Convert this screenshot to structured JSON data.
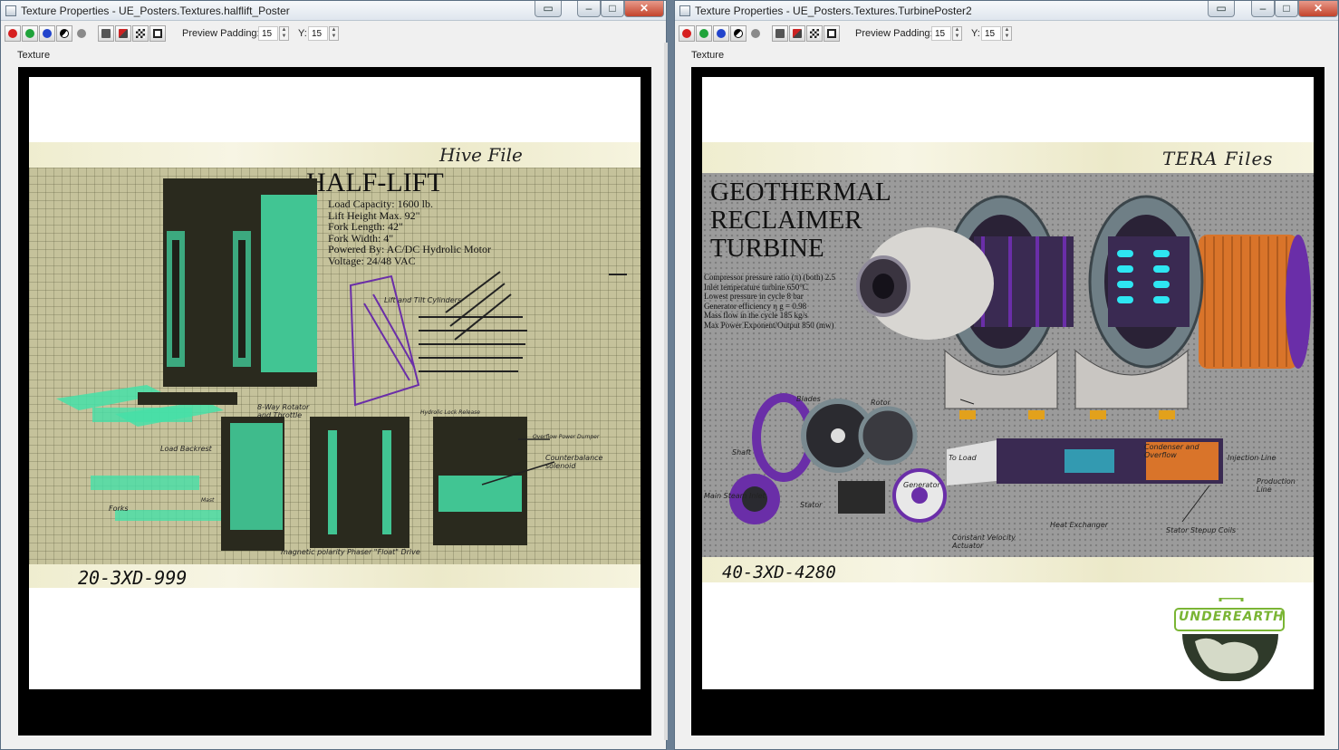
{
  "windows": [
    {
      "title": "Texture Properties - UE_Posters.Textures.halflift_Poster",
      "toolbar": {
        "preview_padding_label": "Preview Padding:",
        "padding_x": "15",
        "y_label": "Y:",
        "padding_y": "15"
      },
      "section_label": "Texture",
      "poster": {
        "header": "Hive File",
        "title": "HALF-LIFT",
        "specs": [
          "Load Capacity: 1600 lb.",
          "Lift Height Max. 92\"",
          "Fork Length: 42\"",
          "Fork Width:    4\"",
          "Powered By: AC/DC Hydrolic Motor",
          "Voltage: 24/48 VAC"
        ],
        "labels": {
          "lift_tilt": "Lift and Tilt Cylinders",
          "rotator": "8-Way Rotator and Throttle",
          "load_backrest": "Load Backrest",
          "forks": "Forks",
          "mast": "Mast",
          "hydrolic_lock": "Hydrolic Lock Release",
          "overflow": "Overflow Power Dumper",
          "counterbalance": "Counterbalance solenoid",
          "drive": "magnetic polarity Phaser \"Float\" Drive"
        },
        "serial": "20-3XD-999"
      }
    },
    {
      "title": "Texture Properties - UE_Posters.Textures.TurbinePoster2",
      "toolbar": {
        "preview_padding_label": "Preview Padding:",
        "padding_x": "15",
        "y_label": "Y:",
        "padding_y": "15"
      },
      "section_label": "Texture",
      "poster": {
        "header": "TERA Files",
        "title_lines": [
          "GEOTHERMAL",
          "RECLAIMER",
          "TURBINE"
        ],
        "specs": [
          "Compressor pressure ratio (π) (both) 2.5",
          "Inlet temperature turbine 650°C",
          "Lowest pressure in cycle 8 bar",
          "Generator efficiency η g = 0.98",
          "Mass flow in the cycle 185 kg/s",
          "Max Power Exponent/Output 850 (mw)"
        ],
        "labels": {
          "blades": "Blades",
          "rotor": "Rotor",
          "shaft": "Shaft",
          "main_steam_inlet": "Main Steam Inlet",
          "stator": "Stator",
          "generator": "Generator",
          "to_load": "To Load",
          "condenser": "Condenser and Overflow",
          "injection_line": "Injection Line",
          "production_line": "Production Line",
          "heat_exchanger": "Heat Exchanger",
          "stator_stepup": "Stator Stepup Coils",
          "constant_velocity": "Constant Velocity Actuator"
        },
        "serial": "40-3XD-4280",
        "logo_text": "UNDEREARTH"
      }
    }
  ],
  "colors": {
    "window_bg": "#f0f0f0",
    "close_button": "#c3432c",
    "poster_grid_olive": "#c5c29b",
    "poster_grid_grey": "#9b9b9b",
    "mint": "#45e0a8",
    "purple": "#6a2ea8",
    "copper": "#d9742a",
    "logo_green": "#7ab534"
  }
}
